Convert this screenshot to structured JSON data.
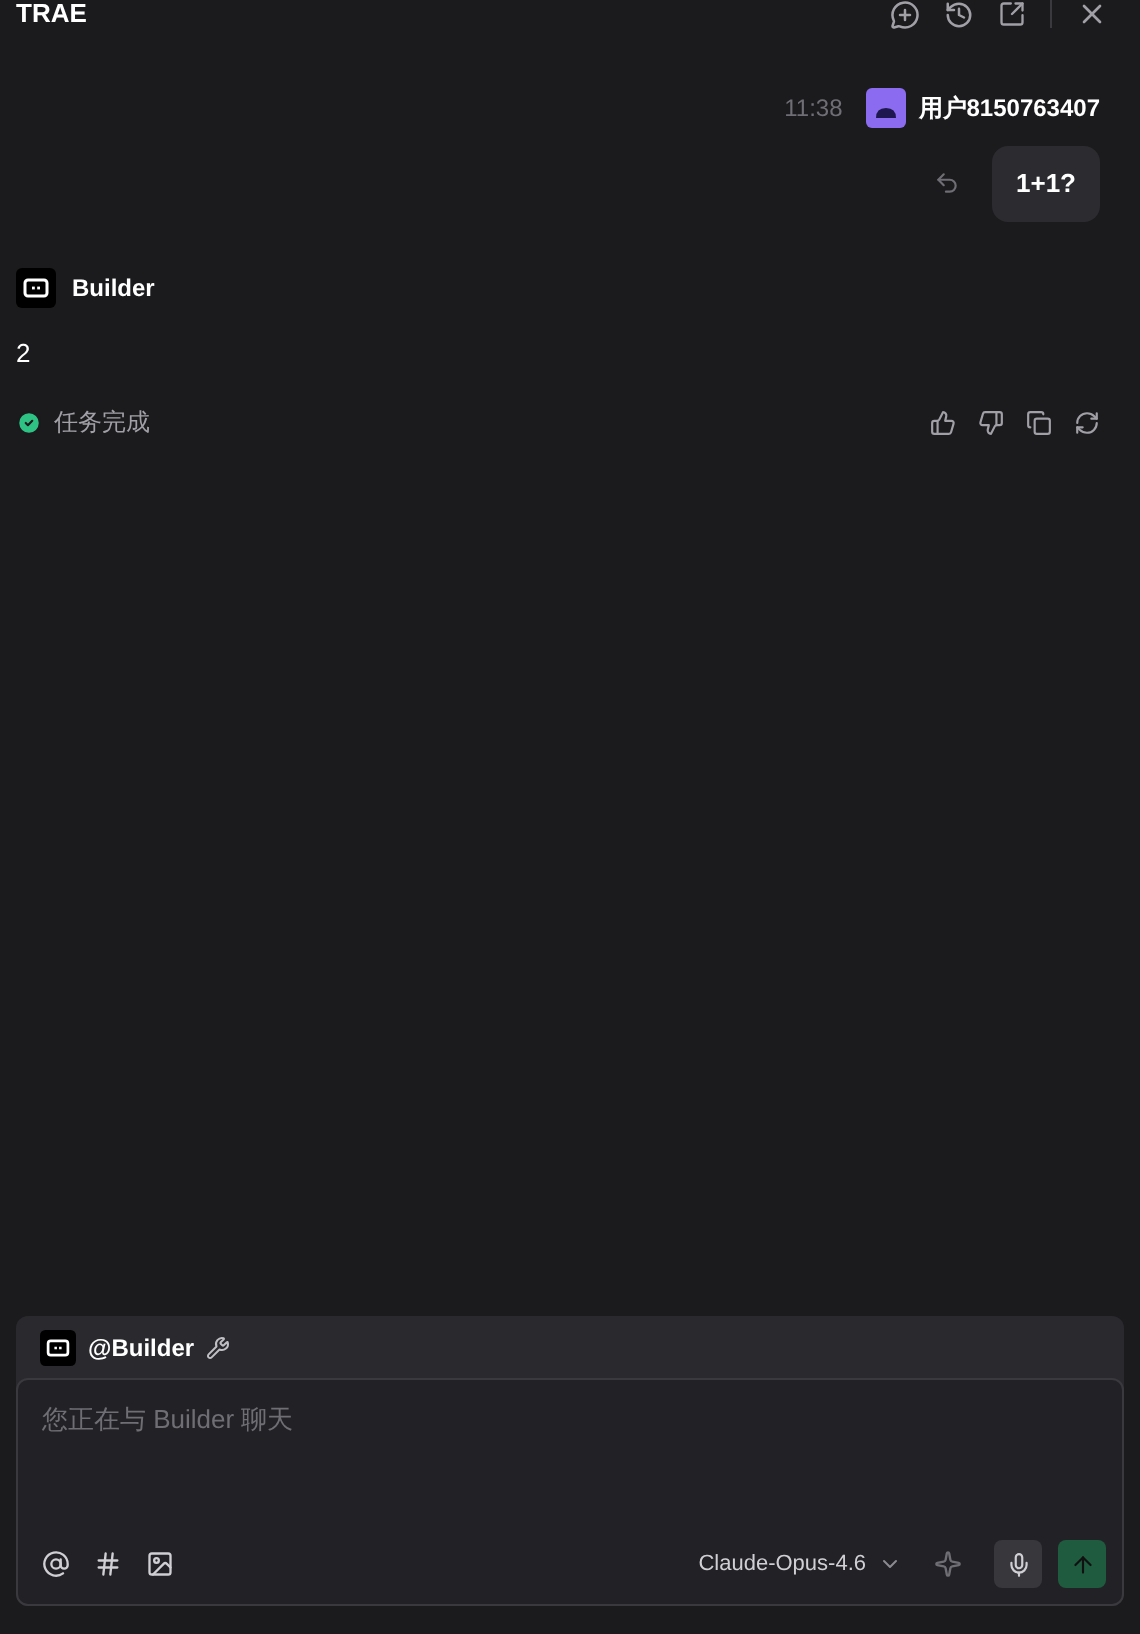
{
  "header": {
    "title": "TRAE"
  },
  "user_message": {
    "time": "11:38",
    "user": "用户8150763407",
    "text": "1+1?"
  },
  "reply": {
    "agent": "Builder",
    "text": "2",
    "status": "任务完成"
  },
  "composer": {
    "agent_tag": "@Builder",
    "placeholder": "您正在与 Builder 聊天",
    "model": "Claude-Opus-4.6"
  }
}
